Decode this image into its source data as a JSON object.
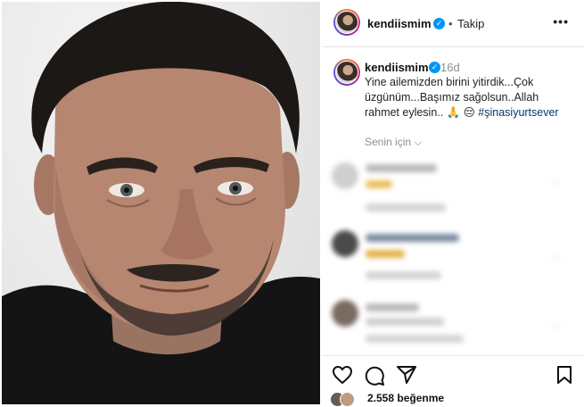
{
  "post": {
    "username": "kendiismim",
    "follow_separator": "•",
    "follow_label": "Takip",
    "more_label": "•••",
    "verified_mark": "✓"
  },
  "caption": {
    "username": "kendiismim",
    "time_ago": "16d",
    "text": "Yine ailemizden birini yitirdik...Çok üzgünüm...Başımız sağolsun..Allah rahmet eylesin..",
    "emoji": "🙏 😔",
    "hashtag": "#şinasiyurtsever",
    "for_you": "Senin için ⌵"
  },
  "actions": {
    "icons": [
      "heart-icon",
      "comment-icon",
      "share-icon",
      "bookmark-icon"
    ]
  },
  "likes": {
    "count_label": "2.558 beğenme"
  },
  "colors": {
    "verified": "#0095f6",
    "hashtag": "#00376b",
    "muted": "#8e8e8e"
  }
}
